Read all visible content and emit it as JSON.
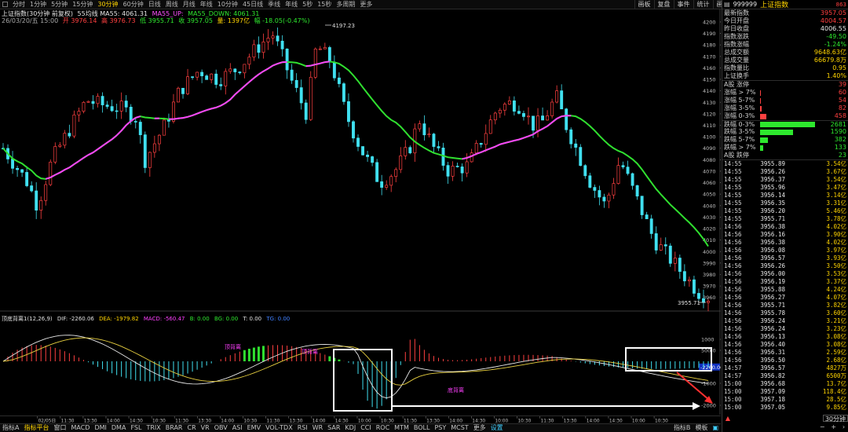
{
  "toolbar": {
    "periods": [
      "分时",
      "1分钟",
      "5分钟",
      "15分钟",
      "30分钟",
      "60分钟",
      "日线",
      "周线",
      "月线",
      "年线",
      "10分钟",
      "45日线",
      "季线",
      "年线",
      "5秒",
      "15秒",
      "多周期",
      "更多"
    ],
    "active_period": "30分钟",
    "actions": [
      "画板",
      "复盘",
      "事件",
      "统计",
      "画线",
      "F10",
      "标记",
      "+自选",
      "返回"
    ]
  },
  "chart_header": {
    "title": "上证指数(30分钟 前复权)",
    "ma_label": "55均线 MA55: 4061.31",
    "ma_up": "MA55_UP: ",
    "ma_down": "MA55_DOWN: 4061.31",
    "date_line": "26/03/20/五 15:00",
    "open": "开 3976.14",
    "high": "高 3976.73",
    "low": "低 3955.71",
    "close": "收 3957.05",
    "volume": "量: 1397亿",
    "change": "幅 -18.05(-0.47%)"
  },
  "price_axis": [
    "4200",
    "4190",
    "4180",
    "4170",
    "4160",
    "4150",
    "4140",
    "4130",
    "4120",
    "4110",
    "4100",
    "4090",
    "4080",
    "4070",
    "4060",
    "4050",
    "4040",
    "4030",
    "4020",
    "4010",
    "4000",
    "3990",
    "3980",
    "3970",
    "3960"
  ],
  "chart_annotations": {
    "high_label": "4197.23",
    "low_label": "3955.71"
  },
  "macd_header": {
    "name": "顶底背离1(12,26,9)",
    "dif": "DIF: -2260.06",
    "dea": "DEA: -1979.82",
    "macd": "MACD: -560.47",
    "b": "B: 0.00",
    "bg": "BG: 0.00",
    "t": "T: 0.00",
    "tg": "TG: 0.00"
  },
  "macd_axis": [
    "1000",
    "500.0",
    "-1000",
    "-2000"
  ],
  "macd_current": "-2260.06",
  "macd_labels": [
    "顶背离",
    "顶背离",
    "底背离"
  ],
  "time_axis": [
    "02/05日",
    "11:30",
    "13:30",
    "14:00",
    "14:30",
    "10:30",
    "11:30",
    "13:30",
    "14:00",
    "10:30",
    "11:30",
    "13:30",
    "14:00",
    "14:30",
    "10:00",
    "10:30",
    "11:30",
    "13:30",
    "14:00",
    "14:30",
    "10:00",
    "10:30",
    "11:30",
    "13:30",
    "14:00",
    "14:30",
    "10:00",
    "10:30"
  ],
  "bottom_tabs": [
    "指标A",
    "指标平台",
    "窗口",
    "MACD",
    "DMI",
    "DMA",
    "FSL",
    "TRIX",
    "BRAR",
    "CR",
    "VR",
    "OBV",
    "ASI",
    "EMV",
    "VOL-TDX",
    "RSI",
    "WR",
    "SAR",
    "KDJ",
    "CCI",
    "ROC",
    "MTM",
    "BOLL",
    "PSY",
    "MCST",
    "更多",
    "设置"
  ],
  "bottom_tabs_right": [
    "指标B",
    "模板"
  ],
  "panel": {
    "code": "999999",
    "name": "上证指数",
    "tag": "863",
    "stats": [
      {
        "label": "最新指数",
        "value": "3957.05",
        "color": "#ff4040"
      },
      {
        "label": "今日开盘",
        "value": "4004.57",
        "color": "#ff4040"
      },
      {
        "label": "昨日收盘",
        "value": "4006.55",
        "color": "#e8e8e8"
      },
      {
        "label": "指数涨跌",
        "value": "-49.50",
        "color": "#2ee82e"
      },
      {
        "label": "指数涨幅",
        "value": "-1.24%",
        "color": "#2ee82e"
      },
      {
        "label": "总成交额",
        "value": "9648.63亿",
        "color": "#ffd400"
      },
      {
        "label": "总成交量",
        "value": "66679.8万",
        "color": "#ffd400"
      },
      {
        "label": "指数量比",
        "value": "0.95",
        "color": "#ffd400"
      },
      {
        "label": "上证换手",
        "value": "1.40%",
        "color": "#ffd400"
      }
    ],
    "breadth": [
      {
        "label": "A股 涨停",
        "value": "39",
        "fill": 0,
        "color": "#ff4040"
      },
      {
        "label": "涨幅 > 7%",
        "value": "60",
        "fill": 0.01,
        "color": "#ff4040"
      },
      {
        "label": "涨幅 5-7%",
        "value": "54",
        "fill": 0.01,
        "color": "#ff4040"
      },
      {
        "label": "涨幅 3-5%",
        "value": "82",
        "fill": 0.02,
        "color": "#ff4040"
      },
      {
        "label": "涨幅 0-3%",
        "value": "458",
        "fill": 0.1,
        "color": "#ff4040"
      },
      {
        "label": "跌幅 0-3%",
        "value": "2681",
        "fill": 0.9,
        "color": "#2ee82e"
      },
      {
        "label": "跌幅 3-5%",
        "value": "1590",
        "fill": 0.54,
        "color": "#2ee82e"
      },
      {
        "label": "跌幅 5-7%",
        "value": "382",
        "fill": 0.13,
        "color": "#2ee82e"
      },
      {
        "label": "跌幅 > 7%",
        "value": "133",
        "fill": 0.05,
        "color": "#2ee82e"
      },
      {
        "label": "A股 跌停",
        "value": "23",
        "fill": 0,
        "color": "#2ee82e"
      }
    ],
    "ticks": [
      {
        "time": "14:55",
        "price": "3955.89",
        "vol": "3.54亿",
        "color": "#ffd400"
      },
      {
        "time": "14:55",
        "price": "3956.26",
        "vol": "3.67亿",
        "color": "#ffd400"
      },
      {
        "time": "14:55",
        "price": "3956.37",
        "vol": "3.54亿",
        "color": "#ffd400"
      },
      {
        "time": "14:55",
        "price": "3955.96",
        "vol": "3.47亿",
        "color": "#ffd400"
      },
      {
        "time": "14:55",
        "price": "3956.14",
        "vol": "3.14亿",
        "color": "#ffd400"
      },
      {
        "time": "14:55",
        "price": "3956.35",
        "vol": "3.31亿",
        "color": "#ffd400"
      },
      {
        "time": "14:55",
        "price": "3956.20",
        "vol": "5.46亿",
        "color": "#ffd400"
      },
      {
        "time": "14:55",
        "price": "3955.71",
        "vol": "3.78亿",
        "color": "#ffd400"
      },
      {
        "time": "14:56",
        "price": "3956.38",
        "vol": "4.02亿",
        "color": "#ffd400"
      },
      {
        "time": "14:56",
        "price": "3956.16",
        "vol": "3.90亿",
        "color": "#ffd400"
      },
      {
        "time": "14:56",
        "price": "3956.38",
        "vol": "4.02亿",
        "color": "#ffd400"
      },
      {
        "time": "14:56",
        "price": "3956.08",
        "vol": "3.97亿",
        "color": "#ffd400"
      },
      {
        "time": "14:56",
        "price": "3956.57",
        "vol": "3.93亿",
        "color": "#ffd400"
      },
      {
        "time": "14:56",
        "price": "3956.26",
        "vol": "3.50亿",
        "color": "#ffd400"
      },
      {
        "time": "14:56",
        "price": "3956.00",
        "vol": "3.53亿",
        "color": "#ffd400"
      },
      {
        "time": "14:56",
        "price": "3956.19",
        "vol": "3.37亿",
        "color": "#ffd400"
      },
      {
        "time": "14:56",
        "price": "3955.88",
        "vol": "4.24亿",
        "color": "#ffd400"
      },
      {
        "time": "14:56",
        "price": "3956.27",
        "vol": "4.07亿",
        "color": "#ffd400"
      },
      {
        "time": "14:56",
        "price": "3955.71",
        "vol": "3.82亿",
        "color": "#ffd400"
      },
      {
        "time": "14:56",
        "price": "3955.78",
        "vol": "3.60亿",
        "color": "#ffd400"
      },
      {
        "time": "14:56",
        "price": "3956.24",
        "vol": "3.21亿",
        "color": "#ffd400"
      },
      {
        "time": "14:56",
        "price": "3956.24",
        "vol": "3.23亿",
        "color": "#ffd400"
      },
      {
        "time": "14:56",
        "price": "3956.13",
        "vol": "3.08亿",
        "color": "#ffd400"
      },
      {
        "time": "14:56",
        "price": "3956.40",
        "vol": "3.08亿",
        "color": "#ffd400"
      },
      {
        "time": "14:56",
        "price": "3956.31",
        "vol": "2.59亿",
        "color": "#ffd400"
      },
      {
        "time": "14:56",
        "price": "3956.50",
        "vol": "2.68亿",
        "color": "#ffd400"
      },
      {
        "time": "14:57",
        "price": "3956.57",
        "vol": "4827万",
        "color": "#ffd400"
      },
      {
        "time": "14:57",
        "price": "3956.82",
        "vol": "6500万",
        "color": "#ffd400"
      },
      {
        "time": "15:00",
        "price": "3956.68",
        "vol": "13.7亿",
        "color": "#ffd400"
      },
      {
        "time": "15:00",
        "price": "3957.09",
        "vol": "118.4亿",
        "color": "#ffd400"
      },
      {
        "time": "15:00",
        "price": "3957.18",
        "vol": "28.5亿",
        "color": "#ffd400"
      },
      {
        "time": "15:00",
        "price": "3957.05",
        "vol": "9.85亿",
        "color": "#ffd400"
      }
    ],
    "period_label": "30分钟"
  },
  "colors": {
    "up": "#ff4040",
    "down": "#40e0f0",
    "ma_up": "#ff40ff",
    "ma_down": "#30e030",
    "accent": "#ffd400"
  }
}
